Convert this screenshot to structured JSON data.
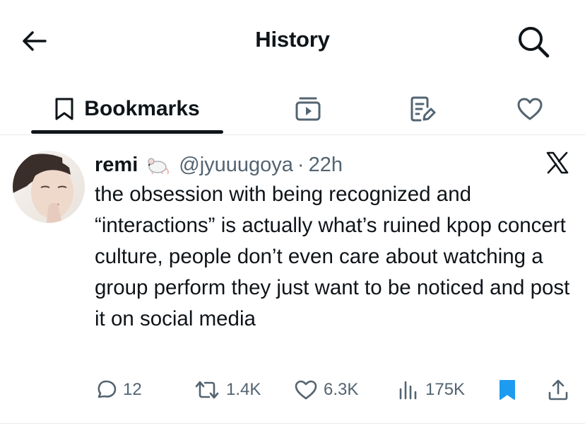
{
  "header": {
    "title": "History",
    "back_icon": "arrow-left-icon",
    "search_icon": "search-icon"
  },
  "tabs": [
    {
      "label": "Bookmarks",
      "icon": "bookmark-icon",
      "active": true
    },
    {
      "label": "",
      "icon": "media-icon",
      "active": false
    },
    {
      "label": "",
      "icon": "notes-icon",
      "active": false
    },
    {
      "label": "",
      "icon": "heart-icon",
      "active": false
    }
  ],
  "post": {
    "author": "remi",
    "badge": "rat-emoji",
    "handle": "@jyuuugoya",
    "separator": "·",
    "time": "22h",
    "platform_icon": "x-logo-icon",
    "text": "the obsession with being recognized and “interactions” is actually what’s ruined kpop concert culture, people don’t even care about watching a group perform they just want to be noticed and post it on social media",
    "stats": {
      "replies": "12",
      "reposts": "1.4K",
      "likes": "6.3K",
      "views": "175K"
    },
    "bookmarked": true
  },
  "colors": {
    "text": "#0f1419",
    "secondary": "#536471",
    "accent": "#1d9bf0",
    "divider": "#e6e8ea"
  }
}
